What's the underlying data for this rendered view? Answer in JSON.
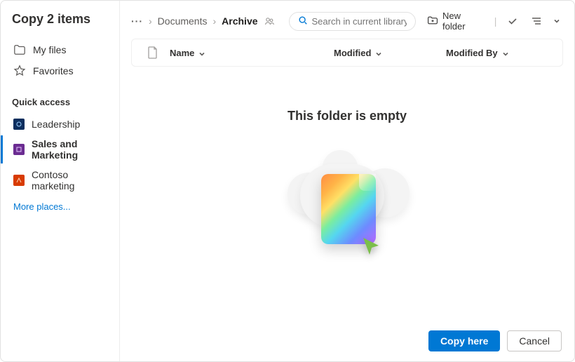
{
  "title": "Copy 2 items",
  "sidebar": {
    "nav": [
      {
        "label": "My files",
        "icon": "folder-icon"
      },
      {
        "label": "Favorites",
        "icon": "star-icon"
      }
    ],
    "quick_access_label": "Quick access",
    "quick_access": [
      {
        "label": "Leadership",
        "color": "qa-blue",
        "active": false
      },
      {
        "label": "Sales and Marketing",
        "color": "qa-purple",
        "active": true
      },
      {
        "label": "Contoso marketing",
        "color": "qa-red",
        "active": false
      }
    ],
    "more_places": "More places..."
  },
  "breadcrumb": {
    "overflow": "···",
    "items": [
      {
        "label": "Documents",
        "current": false
      },
      {
        "label": "Archive",
        "current": true
      }
    ]
  },
  "search": {
    "placeholder": "Search in current library"
  },
  "toolbar": {
    "new_folder": "New folder"
  },
  "columns": {
    "name": "Name",
    "modified": "Modified",
    "modified_by": "Modified By"
  },
  "empty": {
    "title": "This folder is empty"
  },
  "footer": {
    "primary": "Copy here",
    "secondary": "Cancel"
  }
}
